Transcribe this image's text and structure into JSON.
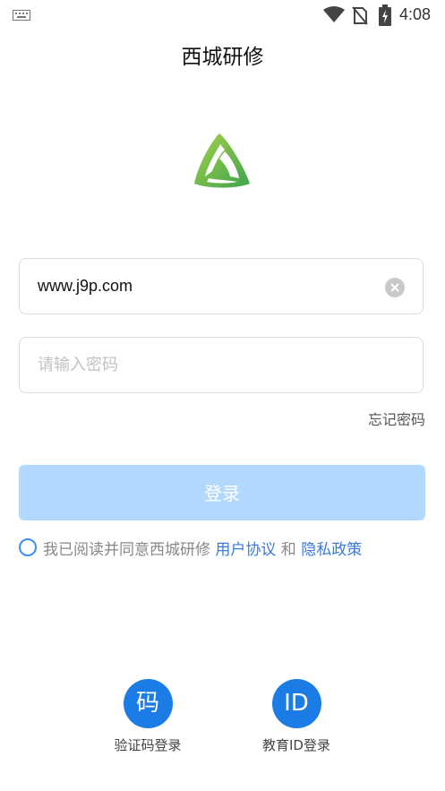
{
  "status_bar": {
    "time": "4:08",
    "icons": [
      "keyboard-icon",
      "wifi-icon",
      "no-sim-icon",
      "battery-charging-icon"
    ]
  },
  "app": {
    "title": "西城研修",
    "logo_icon": "leaf-triangle-logo",
    "logo_colors": [
      "#8cc63f",
      "#4caf50"
    ]
  },
  "form": {
    "username_value": "www.j9p.com",
    "password_placeholder": "请输入密码",
    "clear_icon": "clear-icon",
    "forgot_password": "忘记密码",
    "login_button": "登录"
  },
  "agreement": {
    "prefix": "我已阅读并同意西城研修 ",
    "user_agreement": "用户协议",
    "and": " 和 ",
    "privacy_policy": "隐私政策",
    "checked": false
  },
  "alt_login": [
    {
      "icon_text": "码",
      "label": "验证码登录"
    },
    {
      "icon_text": "ID",
      "label": "教育ID登录"
    }
  ],
  "colors": {
    "accent": "#1a7ce4",
    "login_disabled": "#b3d8fd",
    "link": "#3a7bd8"
  }
}
